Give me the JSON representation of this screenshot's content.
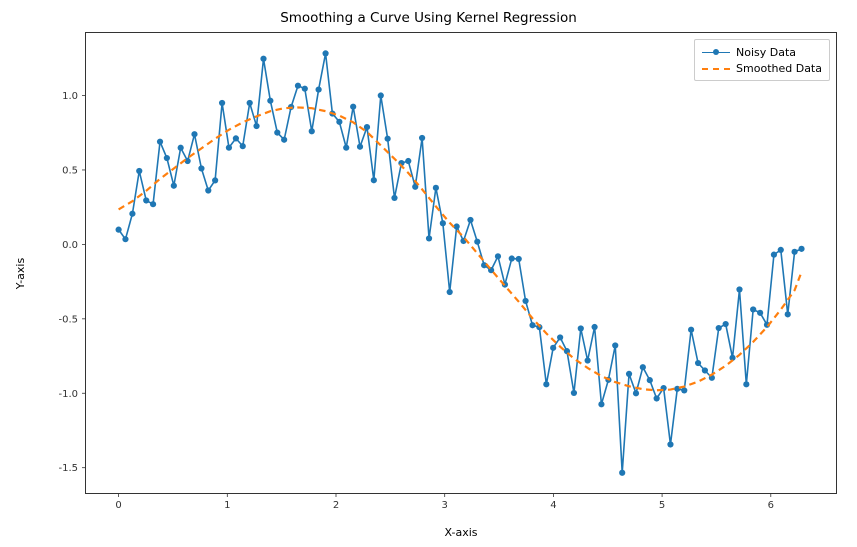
{
  "chart_data": {
    "type": "line",
    "title": "Smoothing a Curve Using Kernel Regression",
    "xlabel": "X-axis",
    "ylabel": "Y-axis",
    "xlim": [
      -0.3,
      6.6
    ],
    "ylim": [
      -1.67,
      1.42
    ],
    "xticks": [
      0,
      1,
      2,
      3,
      4,
      5,
      6
    ],
    "yticks": [
      -1.5,
      -1.0,
      -0.5,
      0.0,
      0.5,
      1.0
    ],
    "series": [
      {
        "name": "Noisy Data",
        "style": "line+markers",
        "color": "#1f77b4",
        "x": [
          0.0,
          0.063,
          0.127,
          0.19,
          0.254,
          0.317,
          0.381,
          0.444,
          0.508,
          0.571,
          0.635,
          0.698,
          0.762,
          0.825,
          0.888,
          0.952,
          1.015,
          1.079,
          1.142,
          1.206,
          1.269,
          1.333,
          1.396,
          1.46,
          1.523,
          1.587,
          1.65,
          1.713,
          1.777,
          1.84,
          1.904,
          1.967,
          2.031,
          2.094,
          2.158,
          2.221,
          2.285,
          2.348,
          2.412,
          2.475,
          2.538,
          2.602,
          2.665,
          2.729,
          2.792,
          2.856,
          2.919,
          2.983,
          3.046,
          3.11,
          3.173,
          3.237,
          3.3,
          3.363,
          3.427,
          3.49,
          3.554,
          3.617,
          3.681,
          3.744,
          3.808,
          3.871,
          3.935,
          3.998,
          4.062,
          4.125,
          4.189,
          4.252,
          4.315,
          4.379,
          4.442,
          4.506,
          4.569,
          4.633,
          4.696,
          4.76,
          4.823,
          4.887,
          4.95,
          5.014,
          5.077,
          5.14,
          5.204,
          5.267,
          5.331,
          5.394,
          5.458,
          5.521,
          5.585,
          5.648,
          5.712,
          5.775,
          5.838,
          5.902,
          5.965,
          6.029,
          6.092,
          6.156,
          6.219,
          6.283
        ],
        "values": [
          0.099,
          0.035,
          0.206,
          0.493,
          0.295,
          0.27,
          0.69,
          0.58,
          0.394,
          0.649,
          0.56,
          0.74,
          0.51,
          0.362,
          0.43,
          0.95,
          0.65,
          0.712,
          0.66,
          0.95,
          0.795,
          1.247,
          0.965,
          0.751,
          0.703,
          0.923,
          1.066,
          1.046,
          0.76,
          1.04,
          1.283,
          0.879,
          0.823,
          0.65,
          0.925,
          0.656,
          0.788,
          0.431,
          1.0,
          0.71,
          0.312,
          0.546,
          0.56,
          0.387,
          0.715,
          0.04,
          0.38,
          0.142,
          -0.32,
          0.12,
          0.023,
          0.164,
          0.018,
          -0.14,
          -0.173,
          -0.08,
          -0.27,
          -0.095,
          -0.098,
          -0.38,
          -0.543,
          -0.556,
          -0.94,
          -0.695,
          -0.625,
          -0.717,
          -0.998,
          -0.565,
          -0.78,
          -0.555,
          -1.074,
          -0.91,
          -0.679,
          -1.534,
          -0.87,
          -1.0,
          -0.825,
          -0.912,
          -1.035,
          -0.965,
          -1.344,
          -0.97,
          -0.981,
          -0.573,
          -0.797,
          -0.847,
          -0.896,
          -0.562,
          -0.535,
          -0.762,
          -0.303,
          -0.94,
          -0.437,
          -0.46,
          -0.54,
          -0.069,
          -0.037,
          -0.47,
          -0.05,
          -0.03
        ]
      },
      {
        "name": "Smoothed Data",
        "style": "dashed",
        "color": "#ff7f0e",
        "x": [
          0.0,
          0.127,
          0.254,
          0.381,
          0.508,
          0.635,
          0.762,
          0.888,
          1.015,
          1.142,
          1.269,
          1.396,
          1.523,
          1.65,
          1.777,
          1.904,
          2.031,
          2.158,
          2.285,
          2.412,
          2.538,
          2.665,
          2.792,
          2.919,
          3.046,
          3.173,
          3.3,
          3.427,
          3.554,
          3.681,
          3.808,
          3.935,
          4.062,
          4.189,
          4.315,
          4.442,
          4.569,
          4.696,
          4.823,
          4.95,
          5.077,
          5.204,
          5.331,
          5.458,
          5.585,
          5.712,
          5.838,
          5.965,
          6.092,
          6.219,
          6.283
        ],
        "values": [
          0.235,
          0.29,
          0.36,
          0.44,
          0.51,
          0.58,
          0.645,
          0.71,
          0.77,
          0.82,
          0.86,
          0.895,
          0.915,
          0.92,
          0.915,
          0.895,
          0.865,
          0.82,
          0.755,
          0.665,
          0.575,
          0.48,
          0.37,
          0.255,
          0.145,
          0.05,
          -0.06,
          -0.17,
          -0.278,
          -0.385,
          -0.497,
          -0.598,
          -0.687,
          -0.767,
          -0.83,
          -0.885,
          -0.925,
          -0.953,
          -0.973,
          -0.98,
          -0.975,
          -0.955,
          -0.922,
          -0.875,
          -0.815,
          -0.742,
          -0.655,
          -0.555,
          -0.438,
          -0.308,
          -0.185
        ]
      }
    ],
    "legend_position": "upper-right"
  },
  "legend": {
    "item1": "Noisy Data",
    "item2": "Smoothed Data"
  }
}
